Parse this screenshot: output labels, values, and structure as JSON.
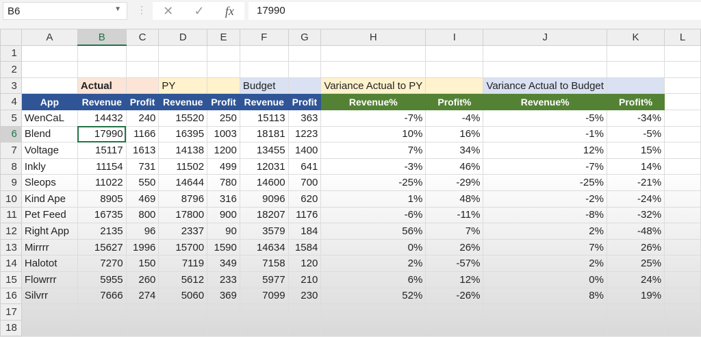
{
  "formula_bar": {
    "name_box": "B6",
    "formula": "17990"
  },
  "columns": [
    "A",
    "B",
    "C",
    "D",
    "E",
    "F",
    "G",
    "H",
    "I",
    "J",
    "K",
    "L"
  ],
  "group_headers": {
    "actual": "Actual",
    "py": "PY",
    "budget": "Budget",
    "var_py": "Variance Actual to PY",
    "var_budget": "Variance Actual to Budget"
  },
  "header_row": [
    "App",
    "Revenue",
    "Profit",
    "Revenue",
    "Profit",
    "Revenue",
    "Profit",
    "Revenue%",
    "Profit%",
    "Revenue%",
    "Profit%"
  ],
  "rows": [
    [
      "WenCaL",
      "14432",
      "240",
      "15520",
      "250",
      "15113",
      "363",
      "-7%",
      "-4%",
      "-5%",
      "-34%"
    ],
    [
      "Blend",
      "17990",
      "1166",
      "16395",
      "1003",
      "18181",
      "1223",
      "10%",
      "16%",
      "-1%",
      "-5%"
    ],
    [
      "Voltage",
      "15117",
      "1613",
      "14138",
      "1200",
      "13455",
      "1400",
      "7%",
      "34%",
      "12%",
      "15%"
    ],
    [
      "Inkly",
      "11154",
      "731",
      "11502",
      "499",
      "12031",
      "641",
      "-3%",
      "46%",
      "-7%",
      "14%"
    ],
    [
      "Sleops",
      "11022",
      "550",
      "14644",
      "780",
      "14600",
      "700",
      "-25%",
      "-29%",
      "-25%",
      "-21%"
    ],
    [
      "Kind Ape",
      "8905",
      "469",
      "8796",
      "316",
      "9096",
      "620",
      "1%",
      "48%",
      "-2%",
      "-24%"
    ],
    [
      "Pet Feed",
      "16735",
      "800",
      "17800",
      "900",
      "18207",
      "1176",
      "-6%",
      "-11%",
      "-8%",
      "-32%"
    ],
    [
      "Right App",
      "2135",
      "96",
      "2337",
      "90",
      "3579",
      "184",
      "56%",
      "7%",
      "2%",
      "-48%"
    ],
    [
      "Mirrrr",
      "15627",
      "1996",
      "15700",
      "1590",
      "14634",
      "1584",
      "0%",
      "26%",
      "7%",
      "26%"
    ],
    [
      "Halotot",
      "7270",
      "150",
      "7119",
      "349",
      "7158",
      "120",
      "2%",
      "-57%",
      "2%",
      "25%"
    ],
    [
      "Flowrrr",
      "5955",
      "260",
      "5612",
      "233",
      "5977",
      "210",
      "6%",
      "12%",
      "0%",
      "24%"
    ],
    [
      "Silvrr",
      "7666",
      "274",
      "5060",
      "369",
      "7099",
      "230",
      "52%",
      "-26%",
      "8%",
      "19%"
    ]
  ],
  "colors": {
    "header_blue": "#2f5597",
    "header_green": "#548235",
    "actual_fill": "#fce4d6",
    "py_fill": "#fff2cc",
    "budget_fill": "#d9e1f2",
    "selection": "#217346"
  }
}
